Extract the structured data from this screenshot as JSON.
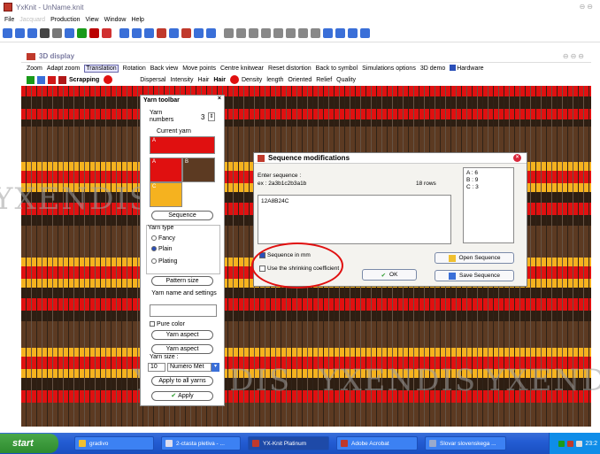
{
  "app": {
    "title": "YxKnit - UnName.knit"
  },
  "menu": {
    "items": [
      "File",
      "Jacquard",
      "Production",
      "View",
      "Window",
      "Help"
    ]
  },
  "display": {
    "title": "3D display",
    "tabs": [
      "Zoom",
      "Adapt zoom",
      "Translation",
      "Rotation",
      "Back view",
      "Move points",
      "Centre knitwear",
      "Reset distortion",
      "Back to symbol",
      "Simulations options",
      "3D demo",
      "Hardware"
    ],
    "active_tab": "Translation",
    "options": {
      "scrapping": "Scrapping",
      "dispersal": "Dispersal",
      "intensity": "Intensity",
      "hair1": "Hair",
      "hair2": "Hair",
      "density": "Density",
      "length": "length",
      "oriented": "Oriented",
      "relief": "Relief",
      "quality": "Quality"
    }
  },
  "yarn_toolbar": {
    "title": "Yarn toolbar",
    "yarn_numbers_label": "Yarn numbers",
    "yarn_numbers_value": "3",
    "current_yarn_label": "Current yarn",
    "swatch_labels": [
      "A",
      "A",
      "B",
      "C"
    ],
    "sequence_button": "Sequence",
    "yarn_type_label": "Yarn type",
    "yarn_types": [
      "Fancy",
      "Plain",
      "Plating"
    ],
    "pattern_size_button": "Pattern size",
    "yarn_name_label": "Yarn name and settings",
    "pure_color_label": "Pure color",
    "yarn_aspect_button1": "Yarn aspect",
    "yarn_aspect_button2": "Yarn aspect",
    "yarn_size_label": "Yarn size :",
    "yarn_size_value": "10",
    "yarn_unit": "Numéro Mét",
    "apply_all_button": "Apply to all yarns",
    "apply_button": "Apply"
  },
  "dialog": {
    "title": "Sequence modifications",
    "enter_label": "Enter sequence :",
    "example_label": "ex : 2a3b1c2b3a1b",
    "rows_label": "18 rows",
    "sequence_value": "12A8B24C",
    "list_items": [
      "A : 6",
      "B : 9",
      "C : 3"
    ],
    "seq_in_mm_label": "Sequence in mm",
    "shrink_label": "Use the shrinking coefficient",
    "open_button": "Open Sequence",
    "save_button": "Save Sequence",
    "ok_button": "OK"
  },
  "watermark": {
    "text": "YXENDIS"
  },
  "taskbar": {
    "start": "start",
    "tasks": [
      "gradivo",
      "2-ctasta pletiva - ...",
      "YX-Knit Platinum",
      "Adobe Acrobat",
      "Slovar slovenskega ..."
    ],
    "clock": "23:2"
  },
  "colors": {
    "red": "#e01010",
    "brown": "#5c3a22",
    "yellow": "#f5b21f",
    "taskbar": "#245dd4"
  }
}
